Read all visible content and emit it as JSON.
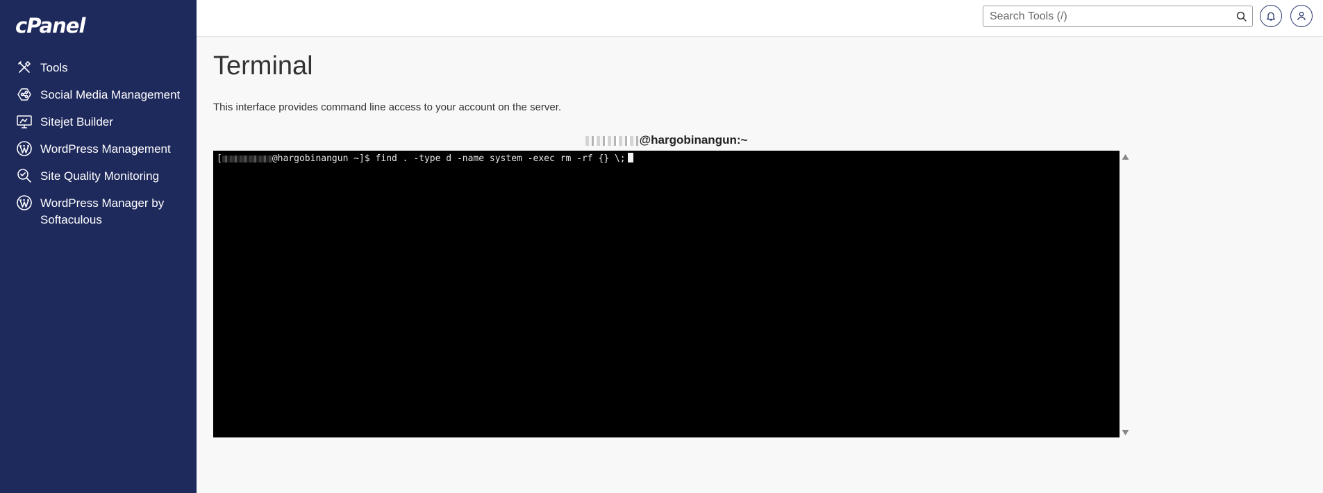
{
  "app": {
    "logo_text": "cPanel"
  },
  "sidebar": {
    "items": [
      {
        "label": "Tools",
        "icon": "tools-icon"
      },
      {
        "label": "Social Media Management",
        "icon": "social-media-icon"
      },
      {
        "label": "Sitejet Builder",
        "icon": "sitejet-icon"
      },
      {
        "label": "WordPress Management",
        "icon": "wordpress-icon"
      },
      {
        "label": "Site Quality Monitoring",
        "icon": "site-quality-icon"
      },
      {
        "label": "WordPress Manager by Softaculous",
        "icon": "wordpress-icon"
      }
    ]
  },
  "header": {
    "search_placeholder": "Search Tools (/)",
    "search_value": ""
  },
  "main": {
    "title": "Terminal",
    "description": "This interface provides command line access to your account on the server.",
    "terminal_title_host": "@hargobinangun:~"
  },
  "terminal": {
    "prompt_open": "[",
    "prompt_host": "@hargobinangun ~]$",
    "command": " find . -type d -name system -exec rm -rf {} \\;"
  },
  "colors": {
    "sidebar_bg": "#1f2a5c",
    "terminal_bg": "#000000",
    "terminal_fg": "#e8e8e8",
    "accent": "#2a3a6e"
  }
}
